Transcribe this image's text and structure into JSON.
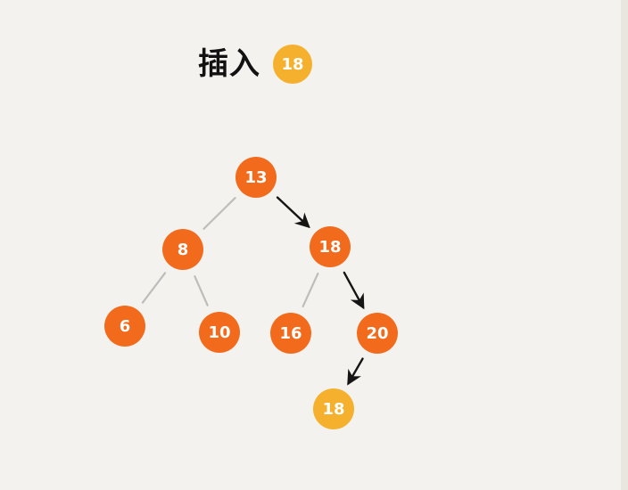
{
  "title": {
    "text": "插入",
    "badge_value": "18"
  },
  "tree": {
    "root": "13",
    "nodes": [
      {
        "id": "n13",
        "label": "13",
        "color": "#f26b1d",
        "highlighted": false
      },
      {
        "id": "n8",
        "label": "8",
        "color": "#f26b1d",
        "highlighted": false
      },
      {
        "id": "n18",
        "label": "18",
        "color": "#f26b1d",
        "highlighted": false
      },
      {
        "id": "n6",
        "label": "6",
        "color": "#f26b1d",
        "highlighted": false
      },
      {
        "id": "n10",
        "label": "10",
        "color": "#f26b1d",
        "highlighted": false
      },
      {
        "id": "n16",
        "label": "16",
        "color": "#f26b1d",
        "highlighted": false
      },
      {
        "id": "n20",
        "label": "20",
        "color": "#f26b1d",
        "highlighted": false
      },
      {
        "id": "n18new",
        "label": "18",
        "color": "#f5b12d",
        "highlighted": true
      }
    ],
    "edges": [
      {
        "from": "n13",
        "to": "n8",
        "kind": "line"
      },
      {
        "from": "n13",
        "to": "n18",
        "kind": "arrow"
      },
      {
        "from": "n8",
        "to": "n6",
        "kind": "line"
      },
      {
        "from": "n8",
        "to": "n10",
        "kind": "line"
      },
      {
        "from": "n18",
        "to": "n16",
        "kind": "line"
      },
      {
        "from": "n18",
        "to": "n20",
        "kind": "arrow"
      },
      {
        "from": "n20",
        "to": "n18new",
        "kind": "arrow"
      }
    ]
  },
  "colors": {
    "background": "#f4f2ee",
    "node": "#f26b1d",
    "inserted": "#f5b12d",
    "line": "#bdbdbd",
    "arrow": "#151515"
  }
}
